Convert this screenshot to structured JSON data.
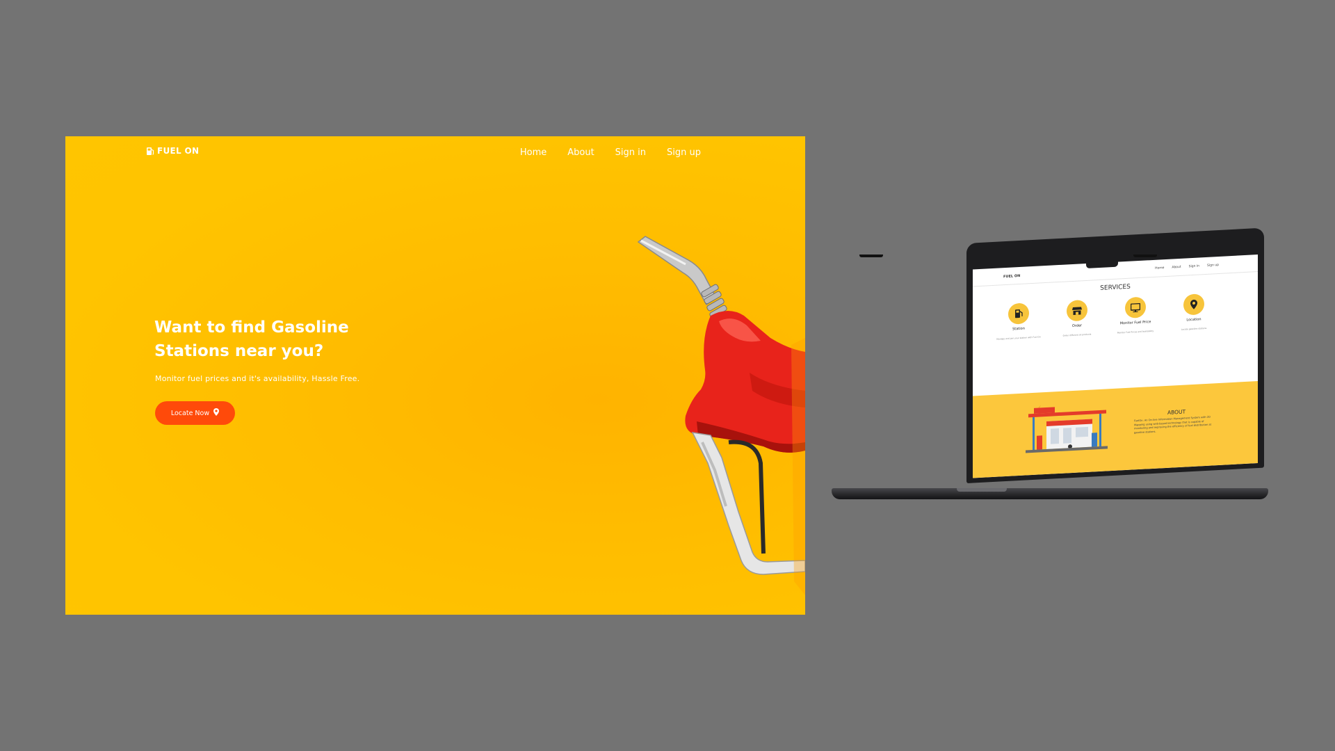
{
  "hero": {
    "brand": "FUEL ON",
    "nav": [
      "Home",
      "About",
      "Sign in",
      "Sign up"
    ],
    "headline_line1": "Want to find Gasoline",
    "headline_line2": "Stations near you?",
    "subtitle": "Monitor fuel prices and it's availability, Hassle Free.",
    "cta_label": "Locate Now",
    "cta_icon": "map-pin-icon",
    "image": "fuel-nozzle-illustration"
  },
  "laptop": {
    "brand": "FUEL ON",
    "nav": [
      "Home",
      "About",
      "Sign in",
      "Sign up"
    ],
    "services_title": "SERVICES",
    "services": [
      {
        "name": "Station",
        "icon": "fuel-pump-icon",
        "desc": "Manage and join your station with Fuel On"
      },
      {
        "name": "Order",
        "icon": "store-icon",
        "desc": "Order different oil products"
      },
      {
        "name": "Monitor Fuel Price",
        "icon": "monitor-icon",
        "desc": "Monitor Fuel Prices and Availability"
      },
      {
        "name": "Location",
        "icon": "map-pin-icon",
        "desc": "Locate gasoline stations"
      }
    ],
    "about_title": "ABOUT",
    "about_text": "FuelOn: An On-line Information Management System with 2D Mapping using web-based technology that is capable of monitoring and improving the efficiency of fuel distribution at gasoline stations."
  },
  "colors": {
    "background": "#737373",
    "hero_yellow": "#ffc300",
    "cta_orange": "#ff4a0a",
    "nozzle_red": "#e8231b",
    "service_yellow": "#f7c43b"
  }
}
